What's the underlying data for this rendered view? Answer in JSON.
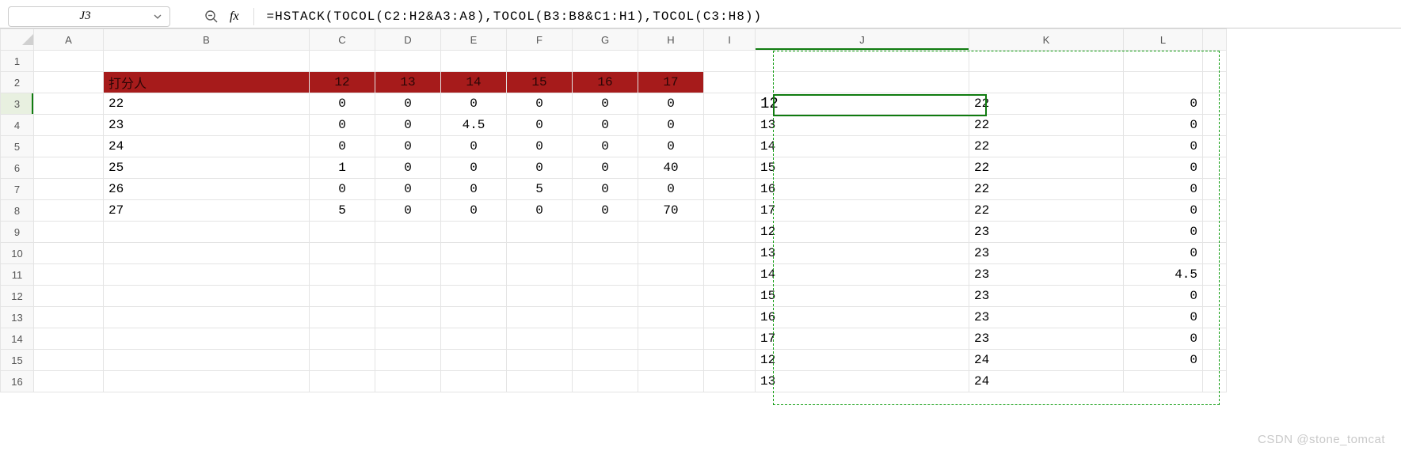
{
  "namebox": {
    "cell": "J3"
  },
  "formula_bar": {
    "fx_label": "fx",
    "formula": "=HSTACK(TOCOL(C2:H2&A3:A8),TOCOL(B3:B8&C1:H1),TOCOL(C3:H8))"
  },
  "columns": [
    "A",
    "B",
    "C",
    "D",
    "E",
    "F",
    "G",
    "H",
    "I",
    "J",
    "K",
    "L",
    ""
  ],
  "rows": [
    "1",
    "2",
    "3",
    "4",
    "5",
    "6",
    "7",
    "8",
    "9",
    "10",
    "11",
    "12",
    "13",
    "14",
    "15",
    "16"
  ],
  "cells": {
    "r2": {
      "B": "打分人",
      "C": "12",
      "D": "13",
      "E": "14",
      "F": "15",
      "G": "16",
      "H": "17"
    },
    "r3": {
      "B": "22",
      "C": "0",
      "D": "0",
      "E": "0",
      "F": "0",
      "G": "0",
      "H": "0",
      "J": "12",
      "K": "22",
      "L": "0"
    },
    "r4": {
      "B": "23",
      "C": "0",
      "D": "0",
      "E": "4.5",
      "F": "0",
      "G": "0",
      "H": "0",
      "J": "13",
      "K": "22",
      "L": "0"
    },
    "r5": {
      "B": "24",
      "C": "0",
      "D": "0",
      "E": "0",
      "F": "0",
      "G": "0",
      "H": "0",
      "J": "14",
      "K": "22",
      "L": "0"
    },
    "r6": {
      "B": "25",
      "C": "1",
      "D": "0",
      "E": "0",
      "F": "0",
      "G": "0",
      "H": "40",
      "J": "15",
      "K": "22",
      "L": "0"
    },
    "r7": {
      "B": "26",
      "C": "0",
      "D": "0",
      "E": "0",
      "F": "5",
      "G": "0",
      "H": "0",
      "J": "16",
      "K": "22",
      "L": "0"
    },
    "r8": {
      "B": "27",
      "C": "5",
      "D": "0",
      "E": "0",
      "F": "0",
      "G": "0",
      "H": "70",
      "J": "17",
      "K": "22",
      "L": "0"
    },
    "r9": {
      "J": "12",
      "K": "23",
      "L": "0"
    },
    "r10": {
      "J": "13",
      "K": "23",
      "L": "0"
    },
    "r11": {
      "J": "14",
      "K": "23",
      "L": "4.5"
    },
    "r12": {
      "J": "15",
      "K": "23",
      "L": "0"
    },
    "r13": {
      "J": "16",
      "K": "23",
      "L": "0"
    },
    "r14": {
      "J": "17",
      "K": "23",
      "L": "0"
    },
    "r15": {
      "J": "12",
      "K": "24",
      "L": "0"
    },
    "r16": {
      "J": "13",
      "K": "24"
    }
  },
  "watermark": "CSDN @stone_tomcat"
}
